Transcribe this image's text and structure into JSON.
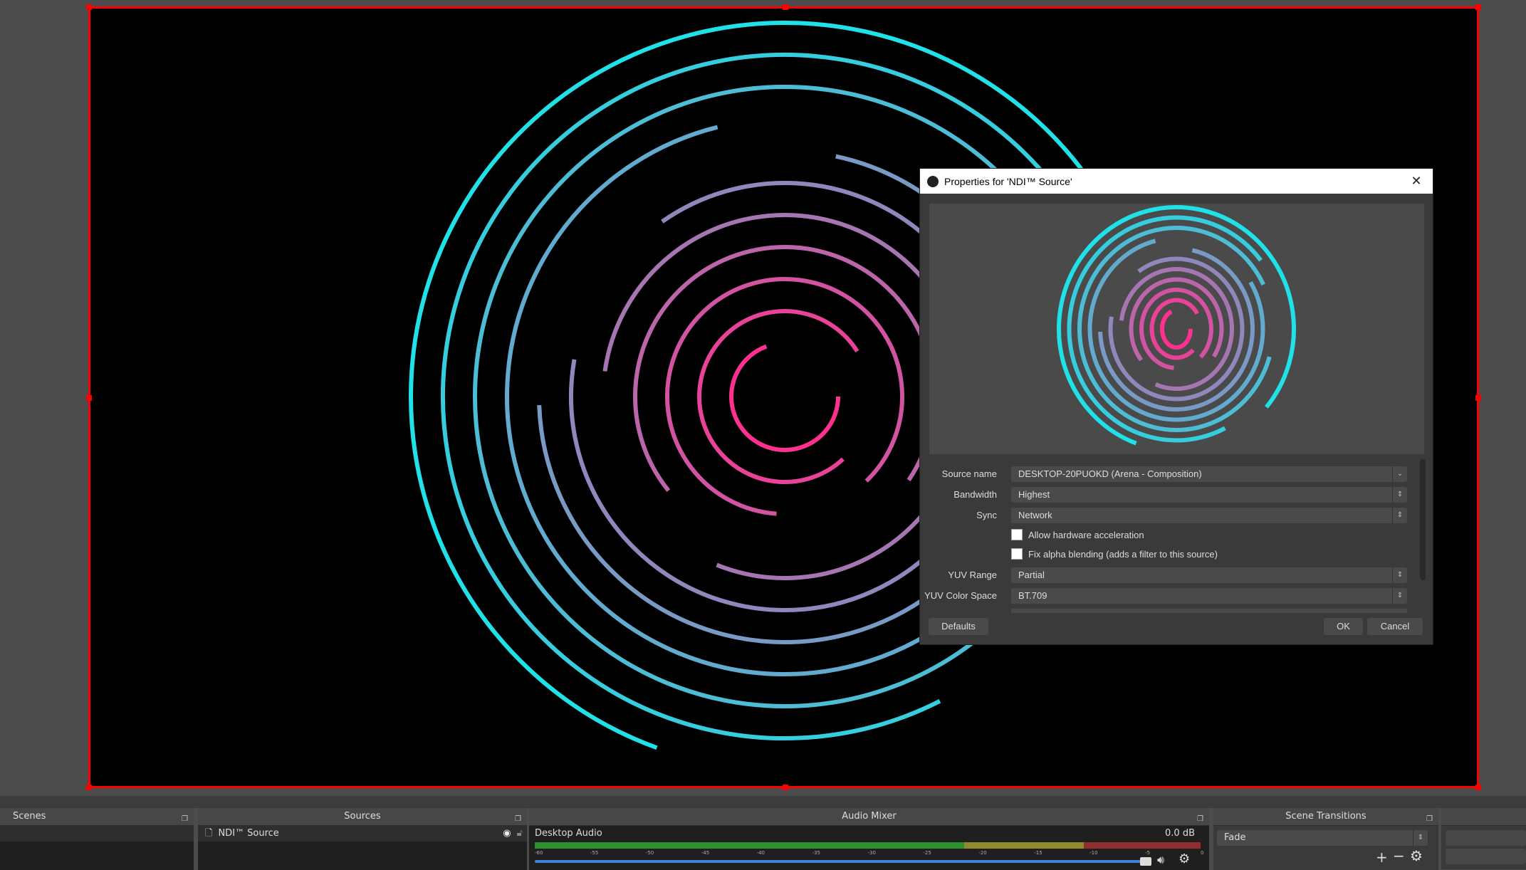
{
  "preview": {
    "border_color": "#ff0000",
    "background": "#000000"
  },
  "dialog": {
    "title": "Properties for 'NDI™ Source'",
    "fields": [
      {
        "label": "Source name",
        "value": "DESKTOP-20PUOKD (Arena -  Composition)",
        "control": "dropdown"
      },
      {
        "label": "Bandwidth",
        "value": "Highest",
        "control": "spin-combo"
      },
      {
        "label": "Sync",
        "value": "Network",
        "control": "spin-combo"
      },
      {
        "label": "YUV Range",
        "value": "Partial",
        "control": "spin-combo"
      },
      {
        "label": "YUV Color Space",
        "value": "BT.709",
        "control": "spin-combo"
      }
    ],
    "checkboxes": [
      {
        "label": "Allow hardware acceleration",
        "checked": false
      },
      {
        "label": "Fix alpha blending (adds a filter to this source)",
        "checked": false
      }
    ],
    "buttons": {
      "defaults": "Defaults",
      "ok": "OK",
      "cancel": "Cancel"
    }
  },
  "docks": {
    "scenes": {
      "title": "Scenes"
    },
    "sources": {
      "title": "Sources",
      "items": [
        {
          "name": "NDI™ Source",
          "visible": true,
          "locked": false
        }
      ]
    },
    "audio_mixer": {
      "title": "Audio Mixer",
      "channels": [
        {
          "name": "Desktop Audio",
          "level": "0.0 dB",
          "volume_fraction": 1.0
        }
      ],
      "scale_ticks": [
        "-60",
        "-55",
        "-50",
        "-45",
        "-40",
        "-35",
        "-30",
        "-25",
        "-20",
        "-15",
        "-10",
        "-5",
        "0"
      ]
    },
    "scene_transitions": {
      "title": "Scene Transitions",
      "selected": "Fade"
    }
  },
  "colors": {
    "accent_blue": "#3b84d8",
    "meter_green": "#2f8f2f",
    "meter_yellow": "#8f8a2f",
    "meter_red": "#8f2f2f"
  }
}
